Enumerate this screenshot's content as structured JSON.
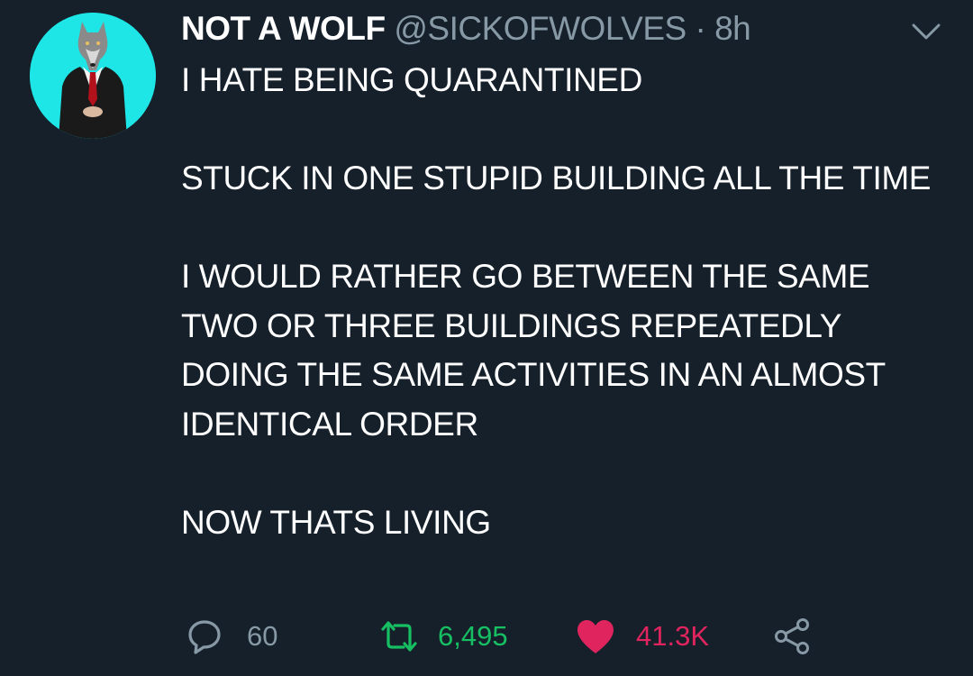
{
  "tweet": {
    "display_name": "NOT A WOLF",
    "handle": "@SICKOFWOLVES",
    "separator": "·",
    "time": "8h",
    "body": [
      "I HATE BEING QUARANTINED",
      "STUCK IN ONE STUPID BUILDING ALL THE TIME",
      "I WOULD RATHER GO BETWEEN THE SAME TWO OR THREE BUILDINGS REPEATEDLY DOING THE SAME ACTIVITIES IN AN ALMOST IDENTICAL ORDER",
      "NOW THATS LIVING"
    ],
    "actions": {
      "reply_count": "60",
      "retweet_count": "6,495",
      "like_count": "41.3K"
    }
  },
  "icons": {
    "menu": "chevron-down-icon",
    "reply": "reply-icon",
    "retweet": "retweet-icon",
    "like": "heart-icon",
    "share": "share-icon"
  },
  "colors": {
    "background": "#15202b",
    "text": "#ffffff",
    "muted": "#8899a6",
    "avatar_bg": "#1ee6e6",
    "retweet": "#17bf63",
    "like": "#e0245e"
  }
}
